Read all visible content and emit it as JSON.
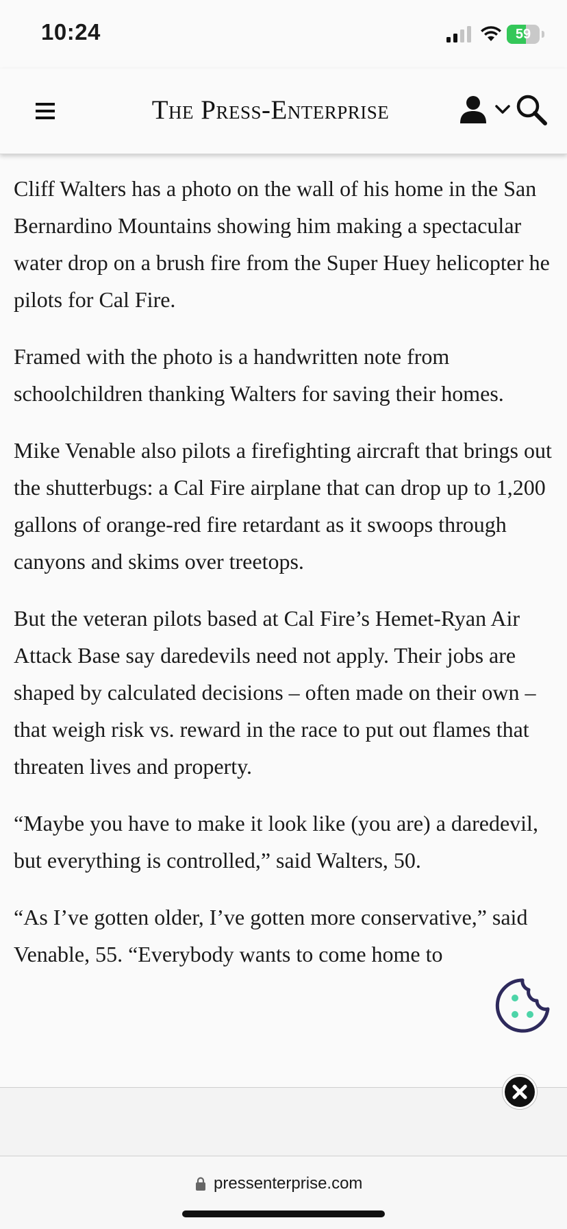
{
  "status_bar": {
    "time": "10:24",
    "battery_percent": "59",
    "battery_level": 0.59,
    "battery_color": "#34c759"
  },
  "header": {
    "logo_text": "The Press-Enterprise",
    "icons": [
      "menu-icon",
      "user-icon",
      "chevron-down-icon",
      "search-icon"
    ]
  },
  "article": {
    "paragraphs": [
      "Cliff Walters has a photo on the wall of his home in the San Bernardino Mountains showing him making a spectacular water drop on a brush fire from the Super Huey helicopter he pilots for Cal Fire.",
      "Framed with the photo is a handwritten note from schoolchildren thanking Walters for saving their homes.",
      "Mike Venable also pilots a firefighting aircraft that brings out the shutterbugs: a Cal Fire airplane that can drop up to 1,200 gallons of orange-red fire retardant as it swoops through canyons and skims over treetops.",
      "But the veteran pilots based at Cal Fire’s Hemet-Ryan Air Attack Base say daredevils need not apply. Their jobs are shaped by calculated decisions – often made on their own – that weigh risk vs. reward in the race to put out flames that threaten lives and property.",
      "“Maybe you have to make it look like (you are) a daredevil, but everything is controlled,” said Walters, 50.",
      "“As I’ve gotten older, I’ve gotten more conservative,” said Venable, 55. “Everybody wants to come home to"
    ]
  },
  "cookie_button": {
    "icon": "cookie-icon",
    "accent": "#4dd4a8",
    "outline": "#2e2a5c"
  },
  "ad": {
    "close_icon": "close-icon"
  },
  "url_bar": {
    "domain": "pressenterprise.com",
    "icon": "lock-icon"
  }
}
